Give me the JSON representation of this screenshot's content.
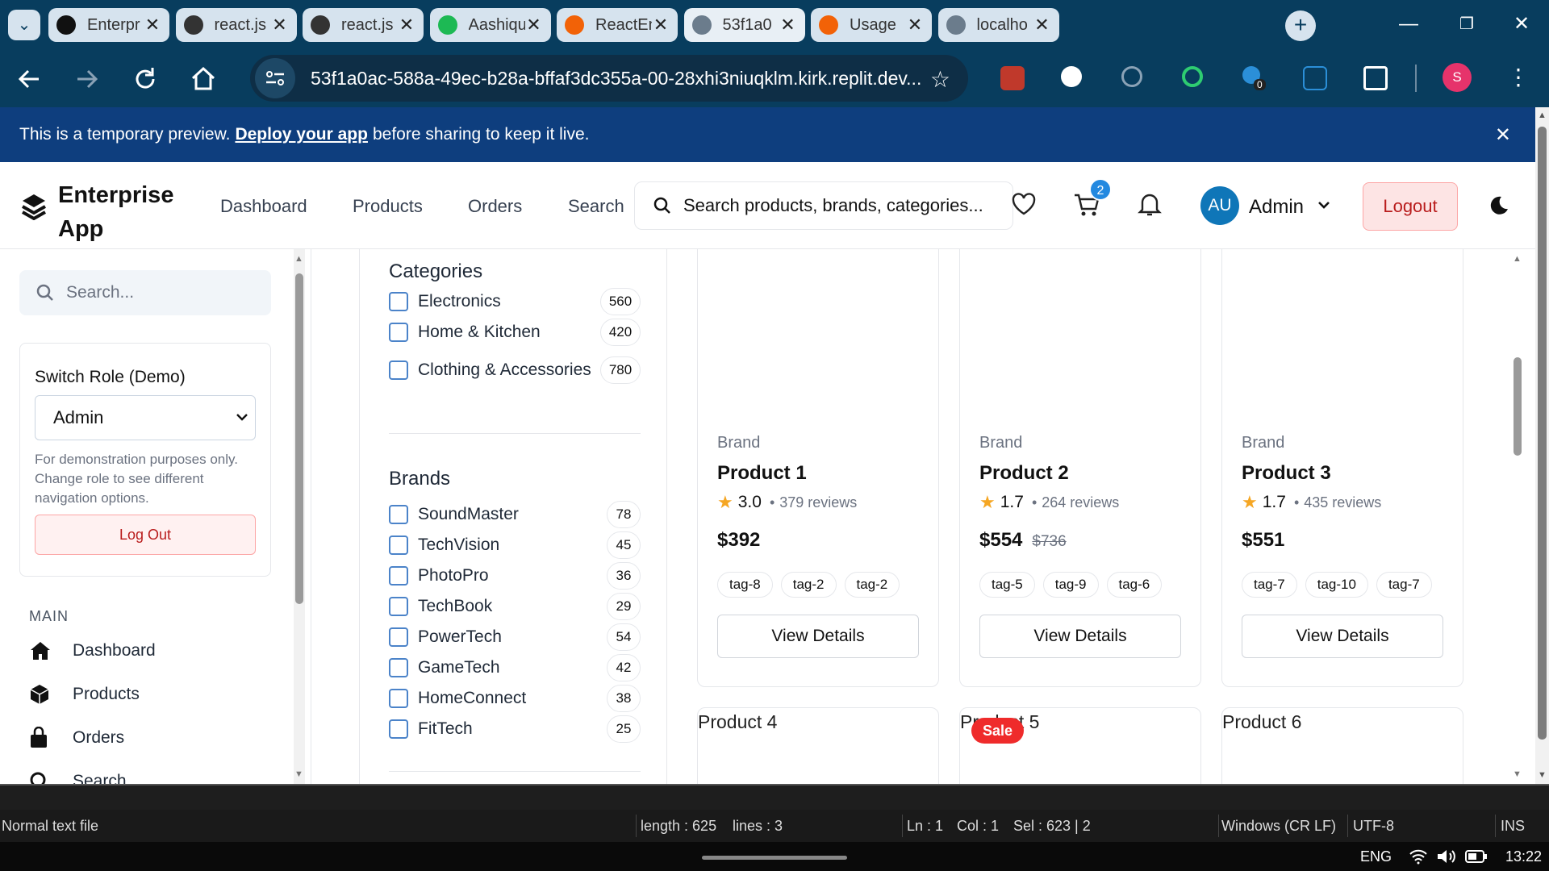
{
  "browser": {
    "tabs": [
      {
        "title": "Enterpr",
        "icon": "github-icon"
      },
      {
        "title": "react.js",
        "icon": "openai-icon"
      },
      {
        "title": "react.js",
        "icon": "openai-icon"
      },
      {
        "title": "Aashiqu",
        "icon": "spotify-icon"
      },
      {
        "title": "ReactEn",
        "icon": "replit-icon"
      },
      {
        "title": "53f1a0",
        "icon": "globe-icon"
      },
      {
        "title": "Usage",
        "icon": "replit-icon"
      },
      {
        "title": "localho",
        "icon": "globe-icon"
      }
    ],
    "active_tab": 5,
    "url": "53f1a0ac-588a-49ec-b28a-bffaf3dc355a-00-28xhi3niuqklm.kirk.replit.dev...",
    "profile_initial": "S",
    "ext_badge": "0",
    "colors": {
      "frame": "#083d5e",
      "tab": "#d6e3ee",
      "banner": "#0e3e7e"
    }
  },
  "banner": {
    "prefix": "This is a temporary preview.",
    "link": "Deploy your app",
    "suffix": "before sharing to keep it live."
  },
  "header": {
    "brand": "Enterprise App",
    "nav": [
      "Dashboard",
      "Products",
      "Orders",
      "Search"
    ],
    "search_placeholder": "Search products, brands, categories...",
    "cart_count": "2",
    "avatar": "AU",
    "user": "Admin",
    "logout": "Logout"
  },
  "sidebar": {
    "search_placeholder": "Search...",
    "role_label": "Switch Role (Demo)",
    "role_value": "Admin",
    "role_help": "For demonstration purposes only. Change role to see different navigation options.",
    "logout": "Log Out",
    "section": "MAIN",
    "items": [
      {
        "label": "Dashboard",
        "icon": "home-icon"
      },
      {
        "label": "Products",
        "icon": "box-icon"
      },
      {
        "label": "Orders",
        "icon": "bag-icon"
      },
      {
        "label": "Search",
        "icon": "search-icon"
      }
    ]
  },
  "filters": {
    "categories_title": "Categories",
    "categories": [
      {
        "label": "Electronics",
        "count": "560"
      },
      {
        "label": "Home & Kitchen",
        "count": "420"
      },
      {
        "label": "Clothing & Accessories",
        "count": "780"
      }
    ],
    "brands_title": "Brands",
    "brands": [
      {
        "label": "SoundMaster",
        "count": "78"
      },
      {
        "label": "TechVision",
        "count": "45"
      },
      {
        "label": "PhotoPro",
        "count": "36"
      },
      {
        "label": "TechBook",
        "count": "29"
      },
      {
        "label": "PowerTech",
        "count": "54"
      },
      {
        "label": "GameTech",
        "count": "42"
      },
      {
        "label": "HomeConnect",
        "count": "38"
      },
      {
        "label": "FitTech",
        "count": "25"
      }
    ]
  },
  "products": [
    {
      "brand": "Brand",
      "name": "Product 1",
      "rating": "3.0",
      "reviews": "379 reviews",
      "price": "$392",
      "old_price": "",
      "tags": [
        "tag-8",
        "tag-2",
        "tag-2"
      ],
      "button": "View Details"
    },
    {
      "brand": "Brand",
      "name": "Product 2",
      "rating": "1.7",
      "reviews": "264 reviews",
      "price": "$554",
      "old_price": "$736",
      "tags": [
        "tag-5",
        "tag-9",
        "tag-6"
      ],
      "button": "View Details"
    },
    {
      "brand": "Brand",
      "name": "Product 3",
      "rating": "1.7",
      "reviews": "435 reviews",
      "price": "$551",
      "old_price": "",
      "tags": [
        "tag-7",
        "tag-10",
        "tag-7"
      ],
      "button": "View Details"
    }
  ],
  "next_row": [
    {
      "alt": "Product 4",
      "badge": ""
    },
    {
      "alt": "Product 5",
      "badge": "Sale"
    },
    {
      "alt": "Product 6",
      "badge": ""
    }
  ],
  "statusbar": {
    "filetype": "Normal text file",
    "length": "length : 625",
    "lines": "lines : 3",
    "ln": "Ln : 1",
    "col": "Col : 1",
    "sel": "Sel : 623 | 2",
    "eol": "Windows (CR LF)",
    "encoding": "UTF-8",
    "mode": "INS"
  },
  "taskbar": {
    "lang": "ENG",
    "time": "13:22"
  }
}
